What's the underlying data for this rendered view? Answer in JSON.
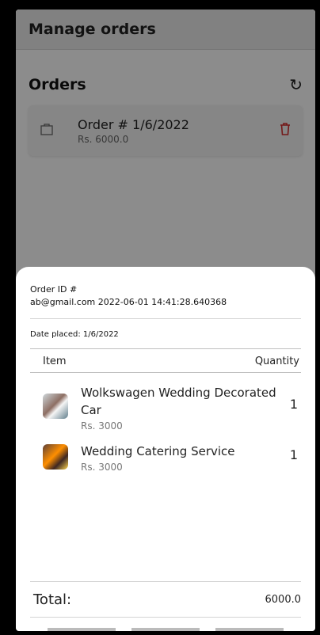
{
  "appbar": {
    "title": "Manage orders"
  },
  "orders": {
    "heading": "Orders",
    "refresh_icon": "refresh-icon",
    "items": [
      {
        "title": "Order # 1/6/2022",
        "amount": "Rs. 6000.0",
        "icon": "shopping-bag-icon",
        "delete_icon": "trash-icon"
      }
    ]
  },
  "sheet": {
    "order_id_label": "Order ID #",
    "order_id_value": "ab@gmail.com 2022-06-01 14:41:28.640368",
    "date_placed": "Date placed: 1/6/2022",
    "columns": {
      "item": "Item",
      "quantity": "Quantity"
    },
    "items": [
      {
        "name": "Wolkswagen Wedding Decorated Car",
        "price": "Rs. 3000",
        "qty": "1"
      },
      {
        "name": "Wedding Catering Service",
        "price": "Rs. 3000",
        "qty": "1"
      }
    ],
    "total_label": "Total:",
    "total_value": "6000.0"
  },
  "colors": {
    "delete": "#d32f2f",
    "overlay": "rgba(0,0,0,0.45)"
  }
}
